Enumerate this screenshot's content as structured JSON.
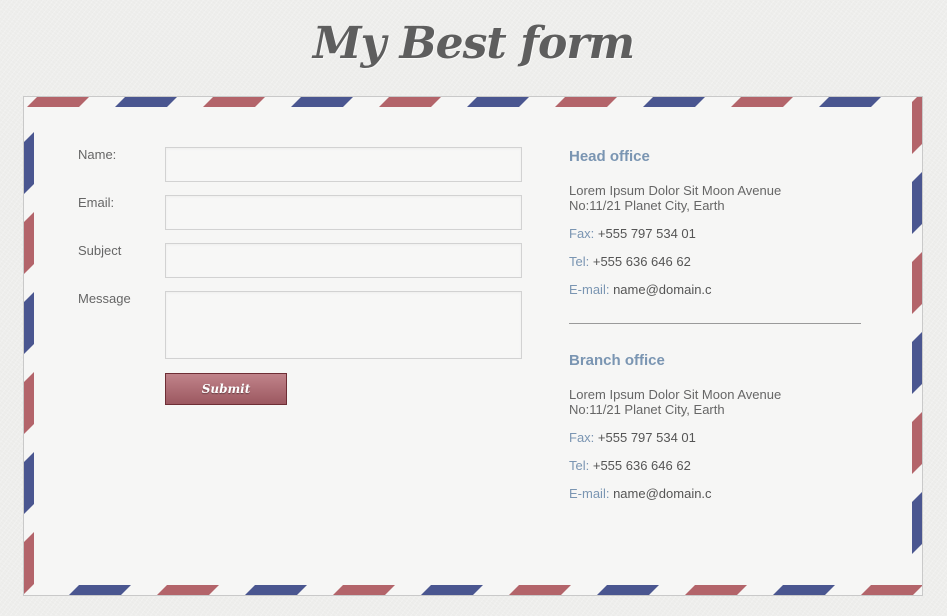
{
  "page": {
    "title": "My Best form"
  },
  "form": {
    "fields": [
      {
        "label": "Name:",
        "value": ""
      },
      {
        "label": "Email:",
        "value": ""
      },
      {
        "label": "Subject",
        "value": ""
      },
      {
        "label": "Message",
        "value": ""
      }
    ],
    "submit_label": "Submit"
  },
  "offices": [
    {
      "title": "Head office",
      "address_line1": "Lorem Ipsum Dolor Sit Moon Avenue",
      "address_line2": "No:11/21 Planet City, Earth",
      "fax_label": "Fax:",
      "fax": "+555 797 534 01",
      "tel_label": "Tel:",
      "tel": "+555 636 646 62",
      "email_label": "E-mail:",
      "email": "name@domain.c"
    },
    {
      "title": "Branch office",
      "address_line1": "Lorem Ipsum Dolor Sit Moon Avenue",
      "address_line2": "No:11/21 Planet City, Earth",
      "fax_label": "Fax:",
      "fax": "+555 797 534 01",
      "tel_label": "Tel:",
      "tel": "+555 636 646 62",
      "email_label": "E-mail:",
      "email": "name@domain.c"
    }
  ],
  "colors": {
    "stripe_red": "#b3646a",
    "stripe_blue": "#4a5690",
    "accent": "#7a95b2",
    "button": "#a8656c"
  }
}
